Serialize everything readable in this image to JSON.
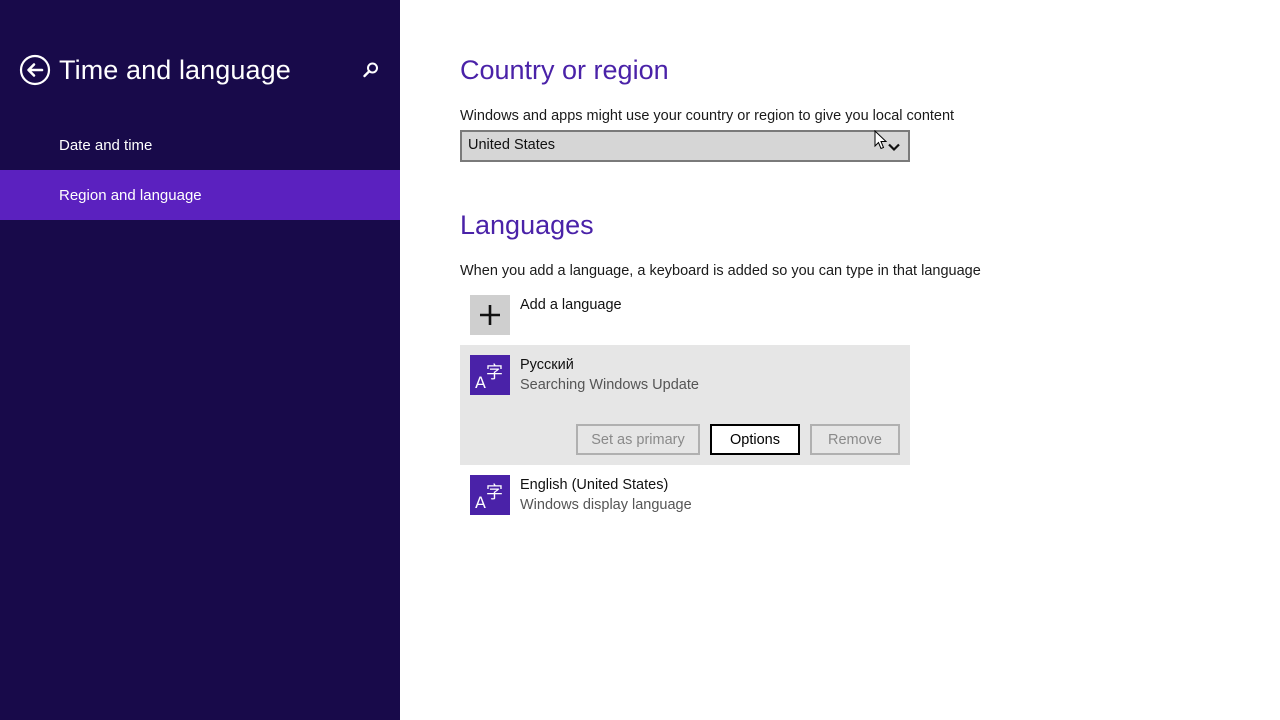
{
  "sidebar": {
    "title": "Time and language",
    "items": [
      {
        "label": "Date and time",
        "active": false
      },
      {
        "label": "Region and language",
        "active": true
      }
    ]
  },
  "country": {
    "heading": "Country or region",
    "description": "Windows and apps might use your country or region to give you local content",
    "selected": "United States"
  },
  "languages": {
    "heading": "Languages",
    "description": "When you add a language, a keyboard is added so you can type in that language",
    "add_label": "Add a language",
    "items": [
      {
        "name": "Русский",
        "status": "Searching Windows Update",
        "buttons": {
          "set_primary": "Set as primary",
          "options": "Options",
          "remove": "Remove"
        }
      },
      {
        "name": "English (United States)",
        "status": "Windows display language"
      }
    ]
  },
  "icons": {
    "back": "back-arrow-icon",
    "search": "search-icon",
    "dropdown": "chevron-down-icon",
    "add": "plus-icon",
    "language": "language-icon"
  },
  "colors": {
    "sidebar_bg": "#180a4a",
    "accent": "#5b21bf",
    "heading": "#4a22a8",
    "tile": "#4a22a8"
  }
}
